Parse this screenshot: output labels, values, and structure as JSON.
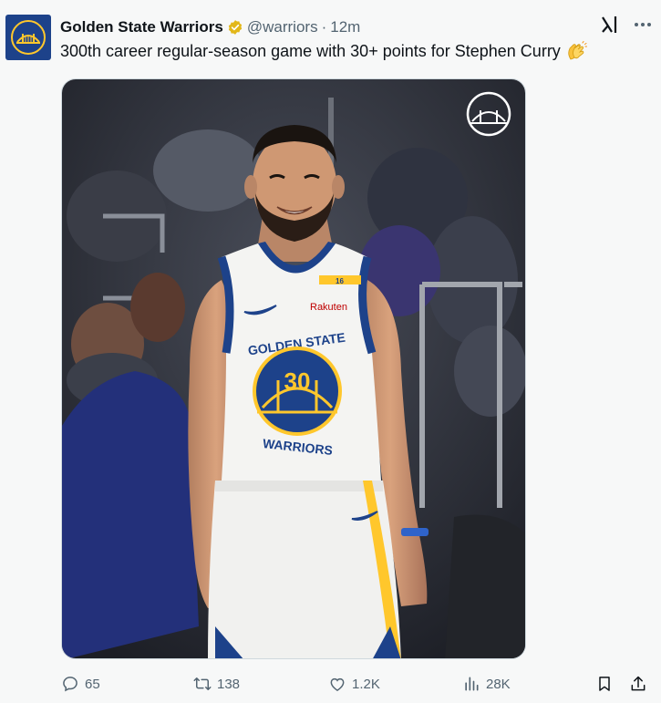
{
  "tweet": {
    "display_name": "Golden State Warriors",
    "handle": "@warriors",
    "separator": "·",
    "time": "12m",
    "text": "300th career regular-season game with 30+ points for Stephen Curry"
  },
  "media": {
    "jersey_line1": "GOLDEN STATE",
    "jersey_line2": "WARRIORS",
    "jersey_number": "30",
    "sponsor": "Rakuten",
    "collar_number": "16"
  },
  "actions": {
    "replies": "65",
    "reposts": "138",
    "likes": "1.2K",
    "views": "28K"
  },
  "colors": {
    "accent_blue": "#1d428a",
    "accent_gold": "#ffc72c",
    "verified_gold": "#e2b719",
    "muted_text": "#536471"
  },
  "icons": [
    "team-logo-icon",
    "verified-badge-icon",
    "grok-icon",
    "more-icon",
    "clapping-hands-icon",
    "reply-icon",
    "repost-icon",
    "like-icon",
    "views-icon",
    "bookmark-icon",
    "share-icon"
  ]
}
